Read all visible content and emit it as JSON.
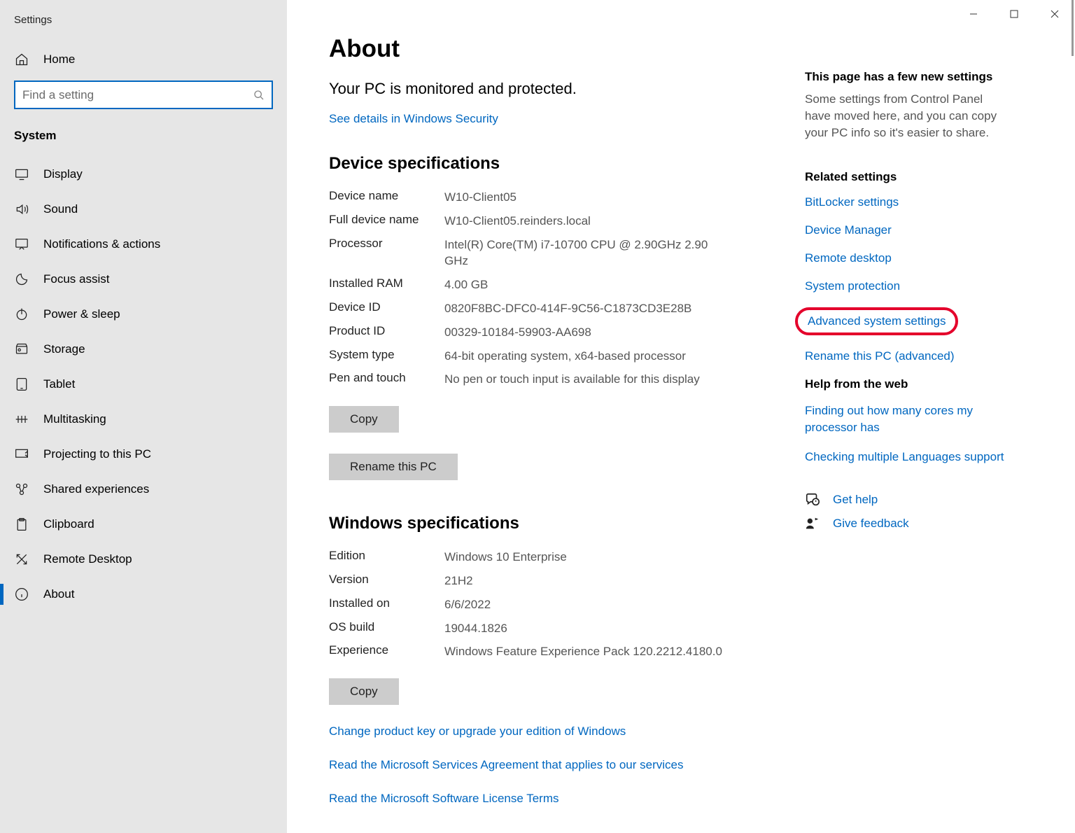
{
  "window": {
    "title": "Settings"
  },
  "sidebar": {
    "home": "Home",
    "search_placeholder": "Find a setting",
    "section": "System",
    "items": [
      {
        "label": "Display"
      },
      {
        "label": "Sound"
      },
      {
        "label": "Notifications & actions"
      },
      {
        "label": "Focus assist"
      },
      {
        "label": "Power & sleep"
      },
      {
        "label": "Storage"
      },
      {
        "label": "Tablet"
      },
      {
        "label": "Multitasking"
      },
      {
        "label": "Projecting to this PC"
      },
      {
        "label": "Shared experiences"
      },
      {
        "label": "Clipboard"
      },
      {
        "label": "Remote Desktop"
      },
      {
        "label": "About"
      }
    ]
  },
  "main": {
    "title": "About",
    "monitored": "Your PC is monitored and protected.",
    "security_link": "See details in Windows Security",
    "device_heading": "Device specifications",
    "device": [
      {
        "k": "Device name",
        "v": "W10-Client05"
      },
      {
        "k": "Full device name",
        "v": "W10-Client05.reinders.local"
      },
      {
        "k": "Processor",
        "v": "Intel(R) Core(TM) i7-10700 CPU @ 2.90GHz   2.90 GHz"
      },
      {
        "k": "Installed RAM",
        "v": "4.00 GB"
      },
      {
        "k": "Device ID",
        "v": "0820F8BC-DFC0-414F-9C56-C1873CD3E28B"
      },
      {
        "k": "Product ID",
        "v": "00329-10184-59903-AA698"
      },
      {
        "k": "System type",
        "v": "64-bit operating system, x64-based processor"
      },
      {
        "k": "Pen and touch",
        "v": "No pen or touch input is available for this display"
      }
    ],
    "copy1": "Copy",
    "rename_btn": "Rename this PC",
    "win_heading": "Windows specifications",
    "win": [
      {
        "k": "Edition",
        "v": "Windows 10 Enterprise"
      },
      {
        "k": "Version",
        "v": "21H2"
      },
      {
        "k": "Installed on",
        "v": "6/6/2022"
      },
      {
        "k": "OS build",
        "v": "19044.1826"
      },
      {
        "k": "Experience",
        "v": "Windows Feature Experience Pack 120.2212.4180.0"
      }
    ],
    "copy2": "Copy",
    "links": [
      "Change product key or upgrade your edition of Windows",
      "Read the Microsoft Services Agreement that applies to our services",
      "Read the Microsoft Software License Terms"
    ]
  },
  "rail": {
    "new_h": "This page has a few new settings",
    "new_p": "Some settings from Control Panel have moved here, and you can copy your PC info so it's easier to share.",
    "related_h": "Related settings",
    "related": [
      "BitLocker settings",
      "Device Manager",
      "Remote desktop",
      "System protection",
      "Advanced system settings",
      "Rename this PC (advanced)"
    ],
    "help_h": "Help from the web",
    "help": [
      "Finding out how many cores my processor has",
      "Checking multiple Languages support"
    ],
    "get_help": "Get help",
    "feedback": "Give feedback"
  }
}
